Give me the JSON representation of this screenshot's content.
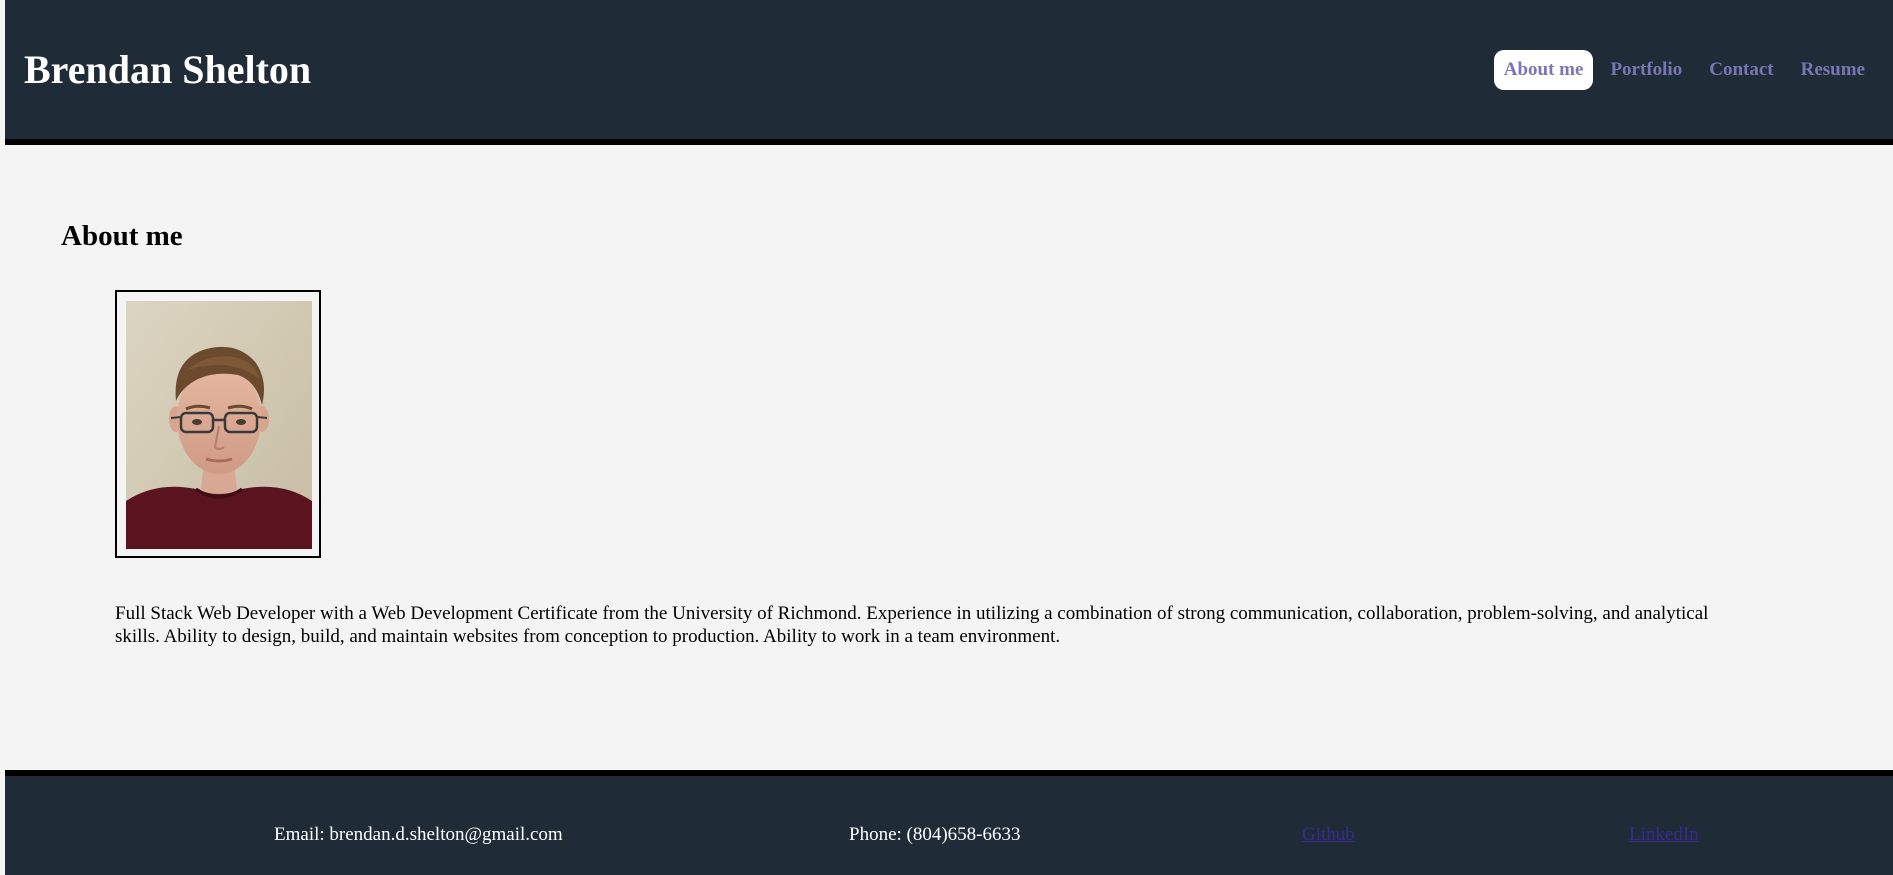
{
  "header": {
    "title": "Brendan Shelton",
    "nav": [
      {
        "label": "About me",
        "active": true
      },
      {
        "label": "Portfolio",
        "active": false
      },
      {
        "label": "Contact",
        "active": false
      },
      {
        "label": "Resume",
        "active": false
      }
    ]
  },
  "main": {
    "section_title": "About me",
    "photo_alt": "profile-photo",
    "bio": "Full Stack Web Developer with a Web Development Certificate from the University of Richmond. Experience in utilizing a combination of strong communication, collaboration, problem-solving, and analytical skills. Ability to design, build, and maintain websites from conception to production. Ability to work in a team environment."
  },
  "footer": {
    "email": "Email: brendan.d.shelton@gmail.com",
    "phone": "Phone: (804)658-6633",
    "github": "Github",
    "linkedin": "LinkedIn"
  },
  "colors": {
    "header_bg": "#1f2c37",
    "page_bg": "#f4f4f4",
    "nav_link": "#7a75b4",
    "footer_link": "#3a2a8f"
  }
}
